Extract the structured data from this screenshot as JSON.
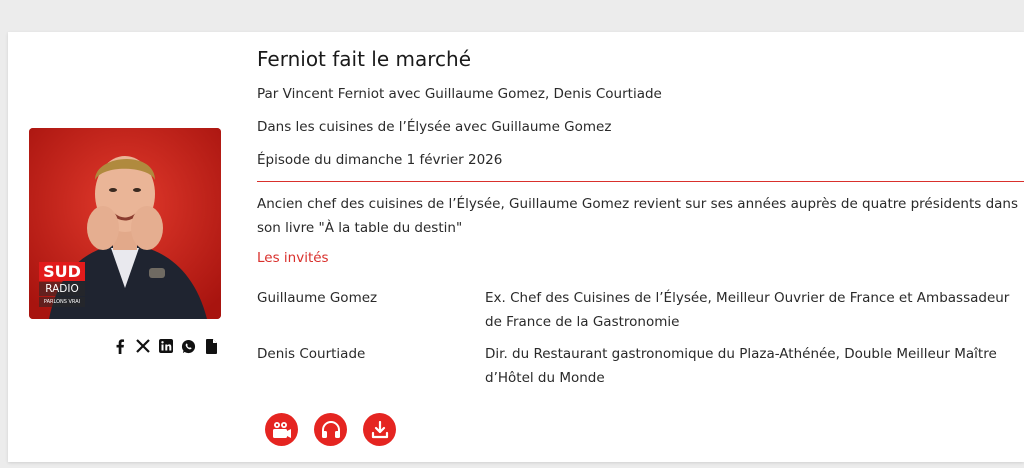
{
  "episode": {
    "show_title": "Ferniot fait le marché",
    "hosts_line": "Par Vincent Ferniot avec Guillaume Gomez, Denis Courtiade",
    "episode_title": "Dans les cuisines de l’Élysée avec Guillaume Gomez",
    "date_line": "Épisode du dimanche 1 février 2026",
    "description": "Ancien chef des cuisines de l’Élysée, Guillaume Gomez revient sur ses années auprès de quatre présidents dans son livre \"À la table du destin\""
  },
  "cover": {
    "logo_main": "SUD",
    "logo_sub": "RADIO",
    "logo_tagline": "PARLONS VRAI"
  },
  "share": {
    "icons": [
      "facebook-icon",
      "x-icon",
      "linkedin-icon",
      "whatsapp-icon",
      "copy-icon"
    ]
  },
  "guests": {
    "heading": "Les invités",
    "list": [
      {
        "name": "Guillaume Gomez",
        "role": "Ex. Chef des Cuisines de l’Élysée, Meilleur Ouvrier de France et Ambassadeur de France de la Gastronomie"
      },
      {
        "name": "Denis Courtiade",
        "role": "Dir. du Restaurant gastronomique du Plaza-Athénée, Double Meilleur Maître d’Hôtel du Monde"
      }
    ]
  },
  "actions": {
    "icons": [
      "video-camera-icon",
      "headphones-icon",
      "download-icon"
    ]
  },
  "colors": {
    "accent": "#e52521",
    "divider": "#d9302c",
    "cover_bg": "#d11d1d"
  }
}
